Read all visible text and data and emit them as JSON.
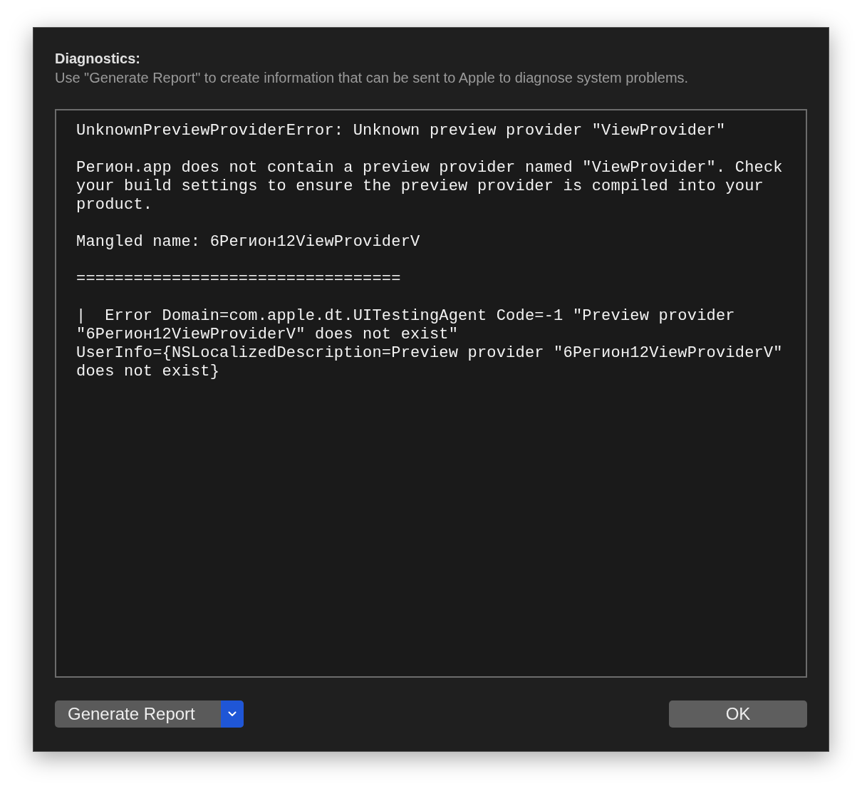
{
  "header": {
    "title": "Diagnostics:",
    "description": "Use \"Generate Report\" to create information that can be sent to Apple to diagnose system problems."
  },
  "log": {
    "paragraphs": [
      "UnknownPreviewProviderError: Unknown preview provider \"ViewProvider\"",
      "Регион.app does not contain a preview provider named \"ViewProvider\". Check\nyour build settings to ensure the preview provider is compiled into your\nproduct.",
      "Mangled name: 6Регион12ViewProviderV",
      "==================================",
      "|  Error Domain=com.apple.dt.UITestingAgent Code=-1 \"Preview provider\n\"6Регион12ViewProviderV\" does not exist\"\nUserInfo={NSLocalizedDescription=Preview provider \"6Регион12ViewProviderV\"\ndoes not exist}"
    ]
  },
  "buttons": {
    "generate": {
      "label": "Generate Report"
    },
    "ok": {
      "label": "OK"
    }
  }
}
